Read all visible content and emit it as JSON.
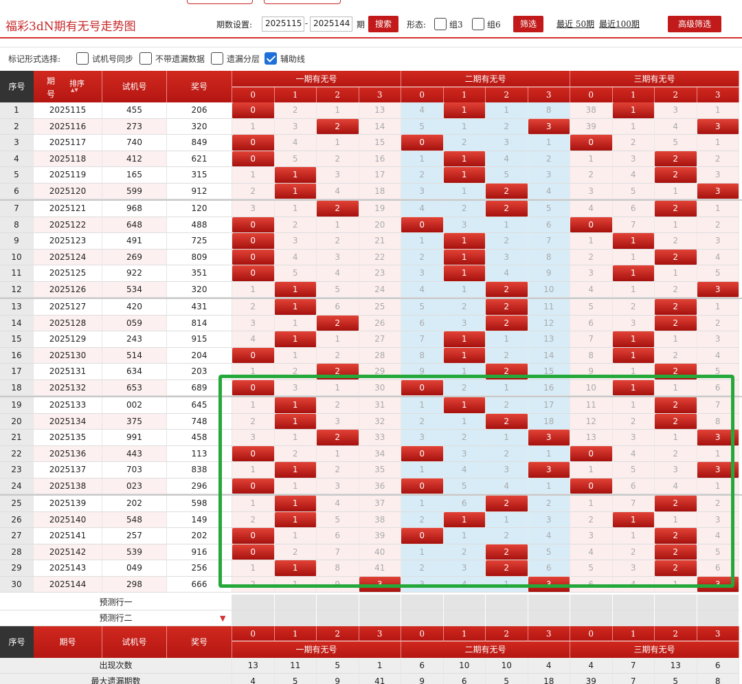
{
  "title": "福彩3dN期有无号走势图",
  "controls": {
    "period_label": "期数设置:",
    "from": "2025115",
    "dash": "-",
    "to": "2025144",
    "period_suffix": "期",
    "search": "搜索",
    "shape_label": "形态:",
    "zu3": "组3",
    "zu6": "组6",
    "filter": "筛选",
    "recent50": "最近 50期",
    "recent100": "最近100期",
    "advanced": "高级筛选"
  },
  "options": {
    "label": "标记形式选择:",
    "o1": "试机号同步",
    "o2": "不带遗漏数据",
    "o3": "遗漏分层",
    "o4": "辅助线",
    "o4_checked": true
  },
  "table": {
    "h_seq": "序号",
    "h_period": "期号",
    "h_sort": "排序",
    "h_trial": "试机号",
    "h_prize": "奖号",
    "groups": [
      "一期有无号",
      "二期有无号",
      "三期有无号"
    ],
    "subheads": [
      "0",
      "1",
      "2",
      "3",
      "0",
      "1",
      "2",
      "3",
      "0",
      "1",
      "2",
      "3"
    ],
    "rows": [
      {
        "seq": "1",
        "p": "2025115",
        "t": "455",
        "w": "206",
        "v": [
          "0",
          "2",
          "1",
          "13",
          "4",
          "1",
          "1",
          "8",
          "38",
          "1",
          "3",
          "1"
        ],
        "h": [
          1,
          0,
          0,
          0,
          0,
          1,
          0,
          0,
          0,
          1,
          0,
          0
        ]
      },
      {
        "seq": "2",
        "p": "2025116",
        "t": "273",
        "w": "320",
        "v": [
          "1",
          "3",
          "2",
          "14",
          "5",
          "1",
          "2",
          "3",
          "39",
          "1",
          "4",
          "3"
        ],
        "h": [
          0,
          0,
          1,
          0,
          0,
          0,
          0,
          1,
          0,
          0,
          0,
          1
        ]
      },
      {
        "seq": "3",
        "p": "2025117",
        "t": "740",
        "w": "849",
        "v": [
          "0",
          "4",
          "1",
          "15",
          "0",
          "2",
          "3",
          "1",
          "0",
          "2",
          "5",
          "1"
        ],
        "h": [
          1,
          0,
          0,
          0,
          1,
          0,
          0,
          0,
          1,
          0,
          0,
          0
        ]
      },
      {
        "seq": "4",
        "p": "2025118",
        "t": "412",
        "w": "621",
        "v": [
          "0",
          "5",
          "2",
          "16",
          "1",
          "1",
          "4",
          "2",
          "1",
          "3",
          "2",
          "2"
        ],
        "h": [
          1,
          0,
          0,
          0,
          0,
          1,
          0,
          0,
          0,
          0,
          1,
          0
        ]
      },
      {
        "seq": "5",
        "p": "2025119",
        "t": "165",
        "w": "315",
        "v": [
          "1",
          "1",
          "3",
          "17",
          "2",
          "1",
          "5",
          "3",
          "2",
          "4",
          "2",
          "3"
        ],
        "h": [
          0,
          1,
          0,
          0,
          0,
          1,
          0,
          0,
          0,
          0,
          1,
          0
        ]
      },
      {
        "seq": "6",
        "p": "2025120",
        "t": "599",
        "w": "912",
        "v": [
          "2",
          "1",
          "4",
          "18",
          "3",
          "1",
          "2",
          "4",
          "3",
          "5",
          "1",
          "3"
        ],
        "h": [
          0,
          1,
          0,
          0,
          0,
          0,
          1,
          0,
          0,
          0,
          0,
          1
        ]
      },
      {
        "seq": "7",
        "p": "2025121",
        "t": "968",
        "w": "120",
        "v": [
          "3",
          "1",
          "2",
          "19",
          "4",
          "2",
          "2",
          "5",
          "4",
          "6",
          "2",
          "1"
        ],
        "h": [
          0,
          0,
          1,
          0,
          0,
          0,
          1,
          0,
          0,
          0,
          1,
          0
        ]
      },
      {
        "seq": "8",
        "p": "2025122",
        "t": "648",
        "w": "488",
        "v": [
          "0",
          "2",
          "1",
          "20",
          "0",
          "3",
          "1",
          "6",
          "0",
          "7",
          "1",
          "2"
        ],
        "h": [
          1,
          0,
          0,
          0,
          1,
          0,
          0,
          0,
          1,
          0,
          0,
          0
        ]
      },
      {
        "seq": "9",
        "p": "2025123",
        "t": "491",
        "w": "725",
        "v": [
          "0",
          "3",
          "2",
          "21",
          "1",
          "1",
          "2",
          "7",
          "1",
          "1",
          "2",
          "3"
        ],
        "h": [
          1,
          0,
          0,
          0,
          0,
          1,
          0,
          0,
          0,
          1,
          0,
          0
        ]
      },
      {
        "seq": "10",
        "p": "2025124",
        "t": "269",
        "w": "809",
        "v": [
          "0",
          "4",
          "3",
          "22",
          "2",
          "1",
          "3",
          "8",
          "2",
          "1",
          "2",
          "4"
        ],
        "h": [
          1,
          0,
          0,
          0,
          0,
          1,
          0,
          0,
          0,
          0,
          1,
          0
        ]
      },
      {
        "seq": "11",
        "p": "2025125",
        "t": "922",
        "w": "351",
        "v": [
          "0",
          "5",
          "4",
          "23",
          "3",
          "1",
          "4",
          "9",
          "3",
          "1",
          "1",
          "5"
        ],
        "h": [
          1,
          0,
          0,
          0,
          0,
          1,
          0,
          0,
          0,
          1,
          0,
          0
        ]
      },
      {
        "seq": "12",
        "p": "2025126",
        "t": "534",
        "w": "320",
        "v": [
          "1",
          "1",
          "5",
          "24",
          "4",
          "1",
          "2",
          "10",
          "4",
          "1",
          "2",
          "3"
        ],
        "h": [
          0,
          1,
          0,
          0,
          0,
          0,
          1,
          0,
          0,
          0,
          0,
          1
        ]
      },
      {
        "seq": "13",
        "p": "2025127",
        "t": "420",
        "w": "431",
        "v": [
          "2",
          "1",
          "6",
          "25",
          "5",
          "2",
          "2",
          "11",
          "5",
          "2",
          "2",
          "1"
        ],
        "h": [
          0,
          1,
          0,
          0,
          0,
          0,
          1,
          0,
          0,
          0,
          1,
          0
        ]
      },
      {
        "seq": "14",
        "p": "2025128",
        "t": "059",
        "w": "814",
        "v": [
          "3",
          "1",
          "2",
          "26",
          "6",
          "3",
          "2",
          "12",
          "6",
          "3",
          "2",
          "2"
        ],
        "h": [
          0,
          0,
          1,
          0,
          0,
          0,
          1,
          0,
          0,
          0,
          1,
          0
        ]
      },
      {
        "seq": "15",
        "p": "2025129",
        "t": "243",
        "w": "915",
        "v": [
          "4",
          "1",
          "1",
          "27",
          "7",
          "1",
          "1",
          "13",
          "7",
          "1",
          "1",
          "3"
        ],
        "h": [
          0,
          1,
          0,
          0,
          0,
          1,
          0,
          0,
          0,
          1,
          0,
          0
        ]
      },
      {
        "seq": "16",
        "p": "2025130",
        "t": "514",
        "w": "204",
        "v": [
          "0",
          "1",
          "2",
          "28",
          "8",
          "1",
          "2",
          "14",
          "8",
          "1",
          "2",
          "4"
        ],
        "h": [
          1,
          0,
          0,
          0,
          0,
          1,
          0,
          0,
          0,
          1,
          0,
          0
        ]
      },
      {
        "seq": "17",
        "p": "2025131",
        "t": "634",
        "w": "203",
        "v": [
          "1",
          "2",
          "2",
          "29",
          "9",
          "1",
          "2",
          "15",
          "9",
          "1",
          "2",
          "5"
        ],
        "h": [
          0,
          0,
          1,
          0,
          0,
          0,
          1,
          0,
          0,
          0,
          1,
          0
        ]
      },
      {
        "seq": "18",
        "p": "2025132",
        "t": "653",
        "w": "689",
        "v": [
          "0",
          "3",
          "1",
          "30",
          "0",
          "2",
          "1",
          "16",
          "10",
          "1",
          "1",
          "6"
        ],
        "h": [
          1,
          0,
          0,
          0,
          1,
          0,
          0,
          0,
          0,
          1,
          0,
          0
        ]
      },
      {
        "seq": "19",
        "p": "2025133",
        "t": "002",
        "w": "645",
        "v": [
          "1",
          "1",
          "2",
          "31",
          "1",
          "1",
          "2",
          "17",
          "11",
          "1",
          "2",
          "7"
        ],
        "h": [
          0,
          1,
          0,
          0,
          0,
          1,
          0,
          0,
          0,
          0,
          1,
          0
        ]
      },
      {
        "seq": "20",
        "p": "2025134",
        "t": "375",
        "w": "748",
        "v": [
          "2",
          "1",
          "3",
          "32",
          "2",
          "1",
          "2",
          "18",
          "12",
          "2",
          "2",
          "8"
        ],
        "h": [
          0,
          1,
          0,
          0,
          0,
          0,
          1,
          0,
          0,
          0,
          1,
          0
        ]
      },
      {
        "seq": "21",
        "p": "2025135",
        "t": "991",
        "w": "458",
        "v": [
          "3",
          "1",
          "2",
          "33",
          "3",
          "2",
          "1",
          "3",
          "13",
          "3",
          "1",
          "3"
        ],
        "h": [
          0,
          0,
          1,
          0,
          0,
          0,
          0,
          1,
          0,
          0,
          0,
          1
        ]
      },
      {
        "seq": "22",
        "p": "2025136",
        "t": "443",
        "w": "113",
        "v": [
          "0",
          "2",
          "1",
          "34",
          "0",
          "3",
          "2",
          "1",
          "0",
          "4",
          "2",
          "1"
        ],
        "h": [
          1,
          0,
          0,
          0,
          1,
          0,
          0,
          0,
          1,
          0,
          0,
          0
        ]
      },
      {
        "seq": "23",
        "p": "2025137",
        "t": "703",
        "w": "838",
        "v": [
          "1",
          "1",
          "2",
          "35",
          "1",
          "4",
          "3",
          "3",
          "1",
          "5",
          "3",
          "3"
        ],
        "h": [
          0,
          1,
          0,
          0,
          0,
          0,
          0,
          1,
          0,
          0,
          0,
          1
        ]
      },
      {
        "seq": "24",
        "p": "2025138",
        "t": "023",
        "w": "296",
        "v": [
          "0",
          "1",
          "3",
          "36",
          "0",
          "5",
          "4",
          "1",
          "0",
          "6",
          "4",
          "1"
        ],
        "h": [
          1,
          0,
          0,
          0,
          1,
          0,
          0,
          0,
          1,
          0,
          0,
          0
        ]
      },
      {
        "seq": "25",
        "p": "2025139",
        "t": "202",
        "w": "598",
        "v": [
          "1",
          "1",
          "4",
          "37",
          "1",
          "6",
          "2",
          "2",
          "1",
          "7",
          "2",
          "2"
        ],
        "h": [
          0,
          1,
          0,
          0,
          0,
          0,
          1,
          0,
          0,
          0,
          1,
          0
        ]
      },
      {
        "seq": "26",
        "p": "2025140",
        "t": "548",
        "w": "149",
        "v": [
          "2",
          "1",
          "5",
          "38",
          "2",
          "1",
          "1",
          "3",
          "2",
          "1",
          "1",
          "3"
        ],
        "h": [
          0,
          1,
          0,
          0,
          0,
          1,
          0,
          0,
          0,
          1,
          0,
          0
        ]
      },
      {
        "seq": "27",
        "p": "2025141",
        "t": "257",
        "w": "202",
        "v": [
          "0",
          "1",
          "6",
          "39",
          "0",
          "1",
          "2",
          "4",
          "3",
          "1",
          "2",
          "4"
        ],
        "h": [
          1,
          0,
          0,
          0,
          1,
          0,
          0,
          0,
          0,
          0,
          1,
          0
        ]
      },
      {
        "seq": "28",
        "p": "2025142",
        "t": "539",
        "w": "916",
        "v": [
          "0",
          "2",
          "7",
          "40",
          "1",
          "2",
          "2",
          "5",
          "4",
          "2",
          "2",
          "5"
        ],
        "h": [
          1,
          0,
          0,
          0,
          0,
          0,
          1,
          0,
          0,
          0,
          1,
          0
        ]
      },
      {
        "seq": "29",
        "p": "2025143",
        "t": "049",
        "w": "256",
        "v": [
          "1",
          "1",
          "8",
          "41",
          "2",
          "3",
          "2",
          "6",
          "5",
          "3",
          "2",
          "6"
        ],
        "h": [
          0,
          1,
          0,
          0,
          0,
          0,
          1,
          0,
          0,
          0,
          1,
          0
        ]
      },
      {
        "seq": "30",
        "p": "2025144",
        "t": "298",
        "w": "666",
        "v": [
          "2",
          "1",
          "9",
          "3",
          "3",
          "4",
          "1",
          "3",
          "6",
          "4",
          "1",
          "3"
        ],
        "h": [
          0,
          0,
          0,
          1,
          0,
          0,
          0,
          1,
          0,
          0,
          0,
          1
        ]
      }
    ],
    "predict1": "预测行一",
    "predict2": "预测行二",
    "stats": [
      {
        "label": "出现次数",
        "v": [
          "13",
          "11",
          "5",
          "1",
          "6",
          "10",
          "10",
          "4",
          "4",
          "7",
          "13",
          "6"
        ]
      },
      {
        "label": "最大遗漏期数",
        "v": [
          "4",
          "5",
          "9",
          "41",
          "9",
          "6",
          "5",
          "18",
          "39",
          "7",
          "5",
          "8"
        ]
      }
    ]
  }
}
